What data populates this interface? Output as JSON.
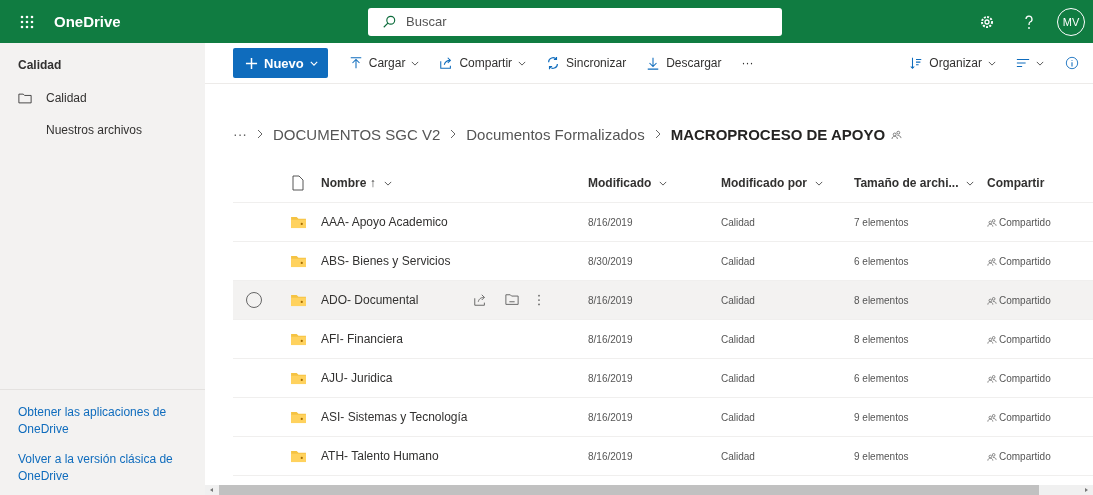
{
  "app": {
    "name": "OneDrive"
  },
  "search": {
    "placeholder": "Buscar"
  },
  "user": {
    "initials": "MV"
  },
  "sidebar": {
    "title": "Calidad",
    "items": [
      {
        "label": "Calidad",
        "kind": "folder"
      },
      {
        "label": "Nuestros archivos",
        "kind": "plain"
      }
    ],
    "links": [
      "Obtener las aplicaciones de OneDrive",
      "Volver a la versión clásica de OneDrive"
    ]
  },
  "toolbar": {
    "new": "Nuevo",
    "items": [
      {
        "label": "Cargar",
        "kind": "upload",
        "caret": true
      },
      {
        "label": "Compartir",
        "kind": "share",
        "caret": true
      },
      {
        "label": "Sincronizar",
        "kind": "sync",
        "caret": false
      },
      {
        "label": "Descargar",
        "kind": "download",
        "caret": false
      }
    ],
    "more": "···",
    "sort": "Organizar"
  },
  "breadcrumb": {
    "more": "···",
    "items": [
      "DOCUMENTOS SGC V2",
      "Documentos Formalizados"
    ],
    "current": "MACROPROCESO DE APOYO"
  },
  "table": {
    "columns": [
      "Nombre ↑",
      "Modificado",
      "Modificado por",
      "Tamaño de archi...",
      "Compartir"
    ],
    "rows": [
      {
        "name": "AAA- Apoyo Academico",
        "modified": "8/16/2019",
        "by": "Calidad",
        "size": "7 elementos",
        "sharing": "Compartido",
        "highlighted": false
      },
      {
        "name": "ABS- Bienes y Servicios",
        "modified": "8/30/2019",
        "by": "Calidad",
        "size": "6 elementos",
        "sharing": "Compartido",
        "highlighted": false
      },
      {
        "name": "ADO- Documental",
        "modified": "8/16/2019",
        "by": "Calidad",
        "size": "8 elementos",
        "sharing": "Compartido",
        "highlighted": true
      },
      {
        "name": "AFI- Financiera",
        "modified": "8/16/2019",
        "by": "Calidad",
        "size": "8 elementos",
        "sharing": "Compartido",
        "highlighted": false
      },
      {
        "name": "AJU- Juridica",
        "modified": "8/16/2019",
        "by": "Calidad",
        "size": "6 elementos",
        "sharing": "Compartido",
        "highlighted": false
      },
      {
        "name": "ASI- Sistemas y Tecnología",
        "modified": "8/16/2019",
        "by": "Calidad",
        "size": "9 elementos",
        "sharing": "Compartido",
        "highlighted": false
      },
      {
        "name": "ATH- Talento Humano",
        "modified": "8/16/2019",
        "by": "Calidad",
        "size": "9 elementos",
        "sharing": "Compartido",
        "highlighted": false
      }
    ]
  }
}
